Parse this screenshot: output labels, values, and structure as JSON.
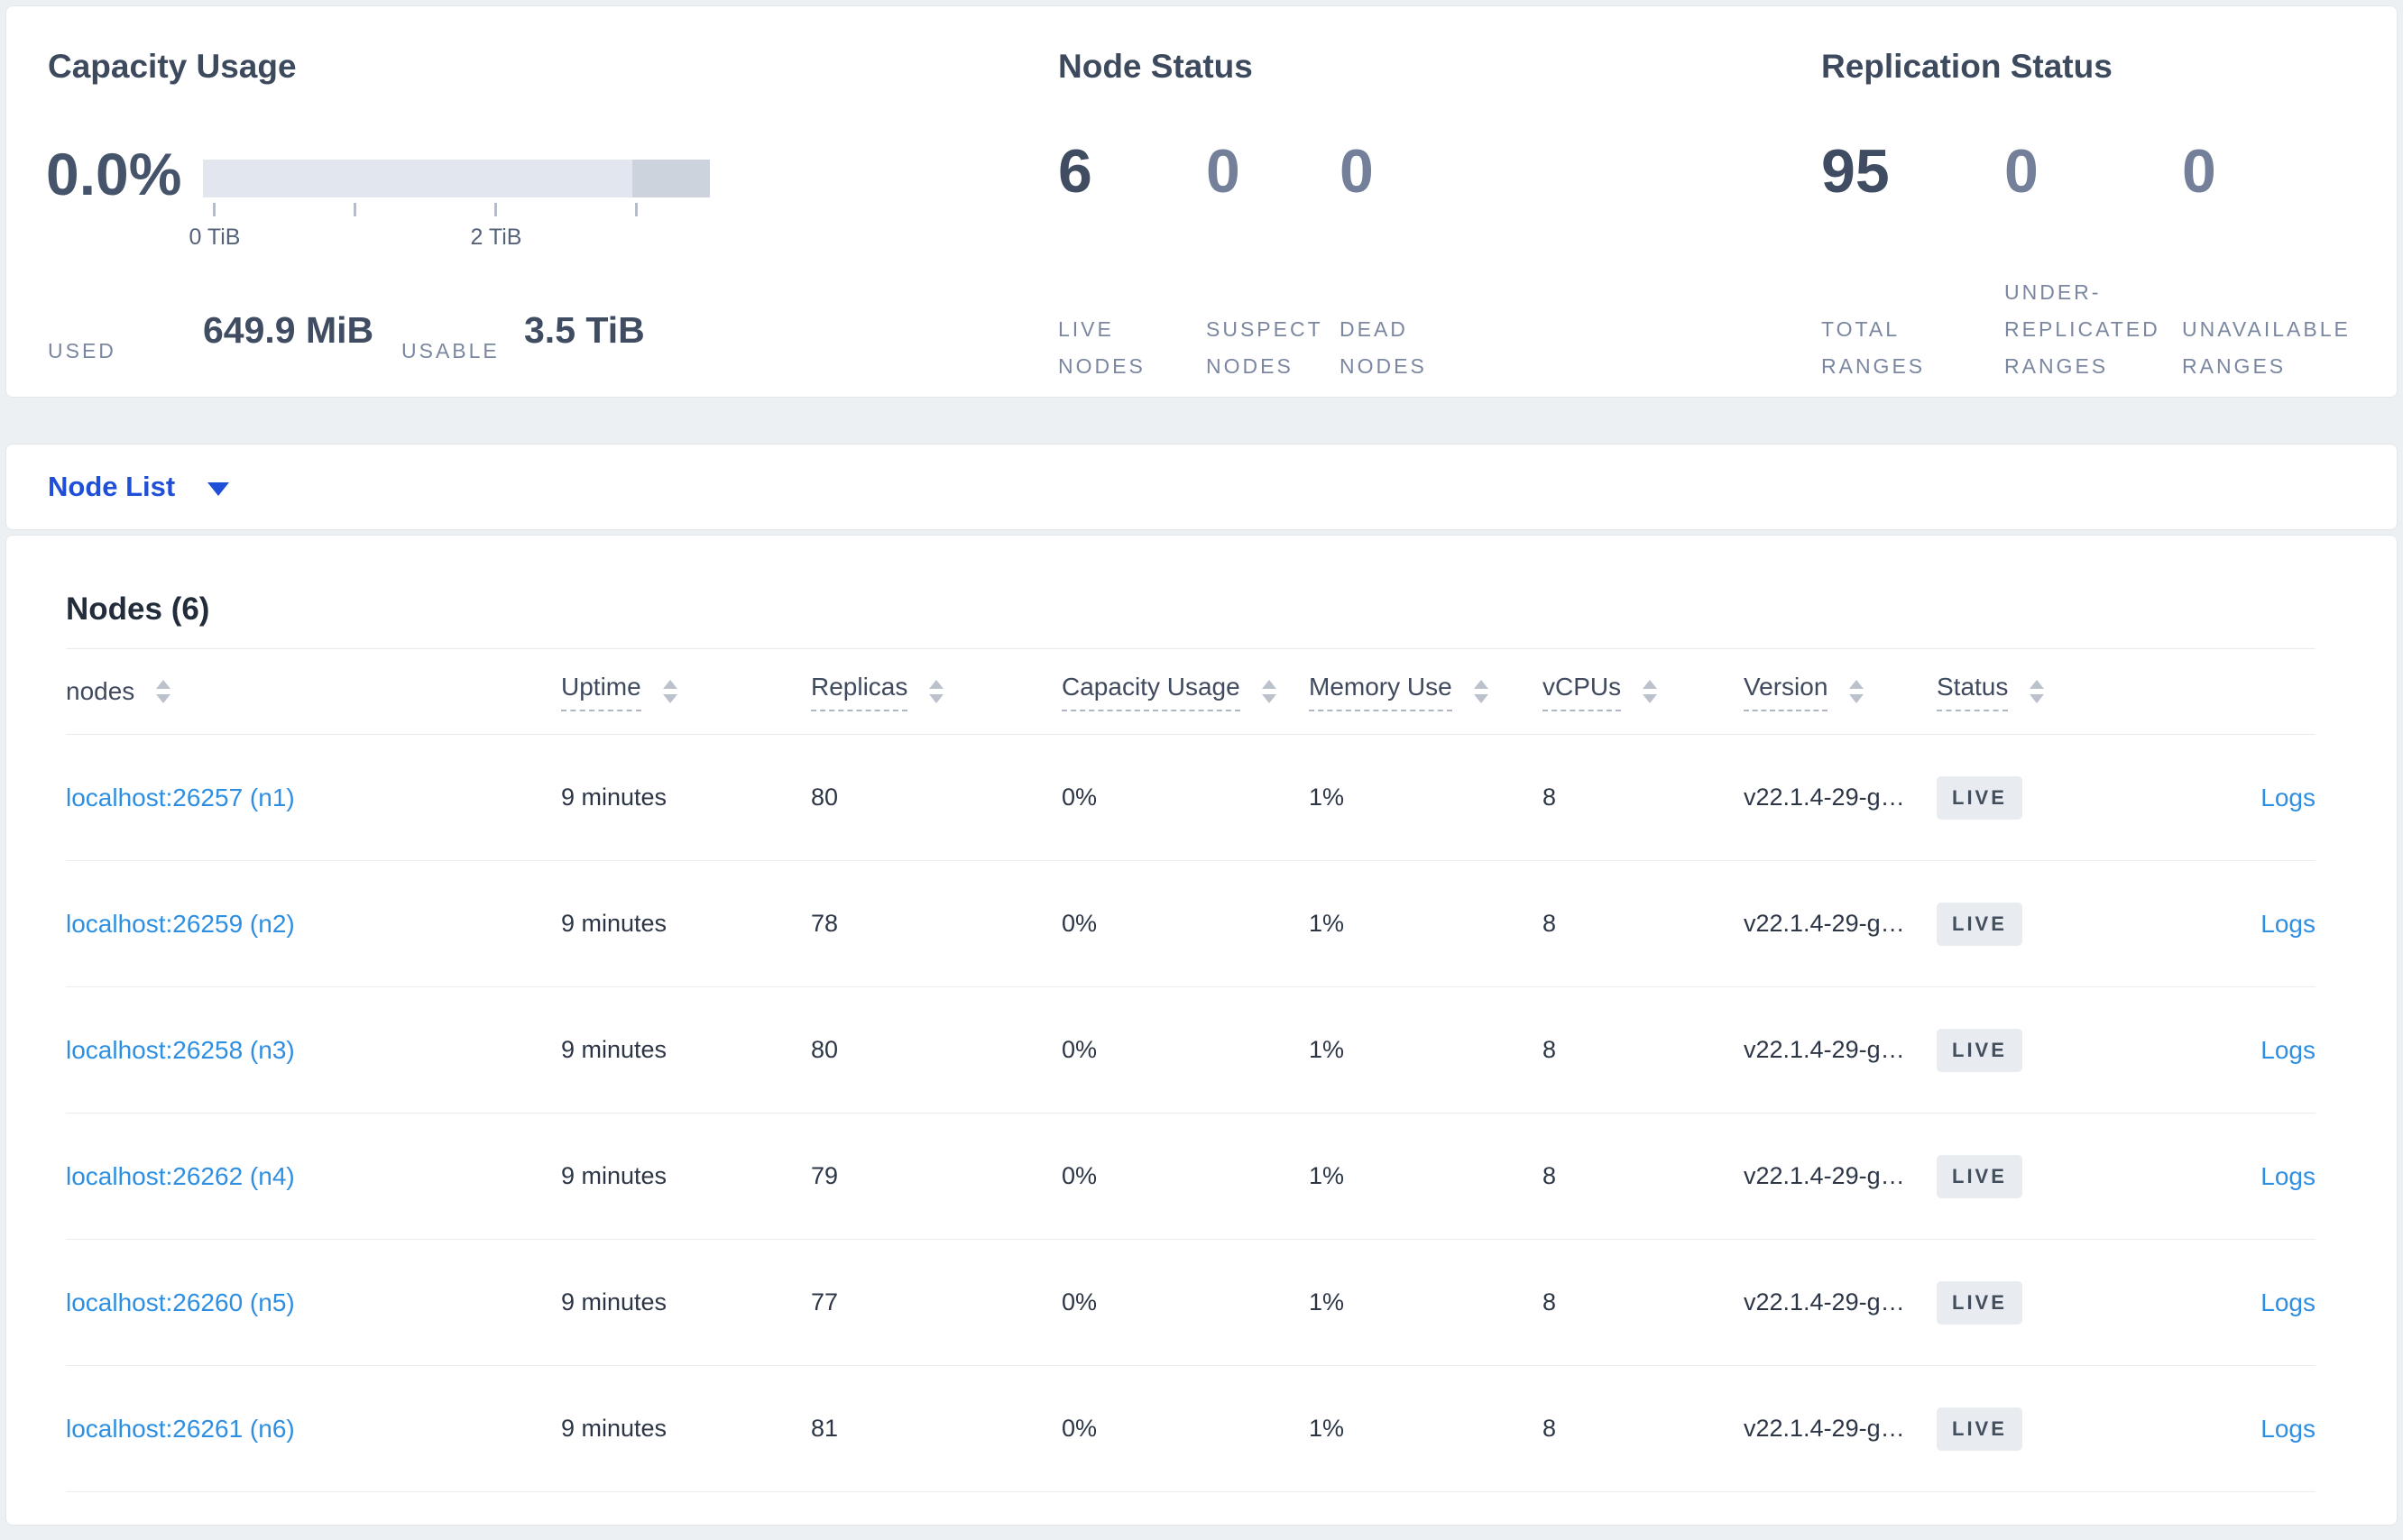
{
  "capacity_usage": {
    "title": "Capacity Usage",
    "percent": "0.0%",
    "tick_labels": [
      "0 TiB",
      "2 TiB"
    ],
    "used_label": "USED",
    "used_value": "649.9 MiB",
    "usable_label": "USABLE",
    "usable_value": "3.5 TiB"
  },
  "node_status": {
    "title": "Node Status",
    "stats": [
      {
        "value": "6",
        "lines": [
          "LIVE",
          "NODES"
        ]
      },
      {
        "value": "0",
        "lines": [
          "SUSPECT",
          "NODES"
        ]
      },
      {
        "value": "0",
        "lines": [
          "DEAD",
          "NODES"
        ]
      }
    ]
  },
  "replication_status": {
    "title": "Replication Status",
    "stats": [
      {
        "value": "95",
        "lines": [
          "TOTAL",
          "RANGES"
        ]
      },
      {
        "value": "0",
        "lines": [
          "UNDER-",
          "REPLICATED",
          "RANGES"
        ]
      },
      {
        "value": "0",
        "lines": [
          "UNAVAILABLE",
          "RANGES"
        ]
      }
    ]
  },
  "view_selector": {
    "label": "Node List"
  },
  "nodes_table": {
    "title": "Nodes (6)",
    "columns": [
      "nodes",
      "Uptime",
      "Replicas",
      "Capacity Usage",
      "Memory Use",
      "vCPUs",
      "Version",
      "Status"
    ],
    "rows": [
      {
        "node": "localhost:26257 (n1)",
        "uptime": "9 minutes",
        "replicas": "80",
        "capacity": "0%",
        "memory": "1%",
        "vcpus": "8",
        "version": "v22.1.4-29-g…",
        "status": "LIVE",
        "logs": "Logs"
      },
      {
        "node": "localhost:26259 (n2)",
        "uptime": "9 minutes",
        "replicas": "78",
        "capacity": "0%",
        "memory": "1%",
        "vcpus": "8",
        "version": "v22.1.4-29-g…",
        "status": "LIVE",
        "logs": "Logs"
      },
      {
        "node": "localhost:26258 (n3)",
        "uptime": "9 minutes",
        "replicas": "80",
        "capacity": "0%",
        "memory": "1%",
        "vcpus": "8",
        "version": "v22.1.4-29-g…",
        "status": "LIVE",
        "logs": "Logs"
      },
      {
        "node": "localhost:26262 (n4)",
        "uptime": "9 minutes",
        "replicas": "79",
        "capacity": "0%",
        "memory": "1%",
        "vcpus": "8",
        "version": "v22.1.4-29-g…",
        "status": "LIVE",
        "logs": "Logs"
      },
      {
        "node": "localhost:26260 (n5)",
        "uptime": "9 minutes",
        "replicas": "77",
        "capacity": "0%",
        "memory": "1%",
        "vcpus": "8",
        "version": "v22.1.4-29-g…",
        "status": "LIVE",
        "logs": "Logs"
      },
      {
        "node": "localhost:26261 (n6)",
        "uptime": "9 minutes",
        "replicas": "81",
        "capacity": "0%",
        "memory": "1%",
        "vcpus": "8",
        "version": "v22.1.4-29-g…",
        "status": "LIVE",
        "logs": "Logs"
      }
    ]
  },
  "colors": {
    "selector_blue": "#1f4fd9",
    "link_blue": "#2e8fe2",
    "badge_bg": "#e8ebef",
    "badge_text": "#424e5e"
  }
}
